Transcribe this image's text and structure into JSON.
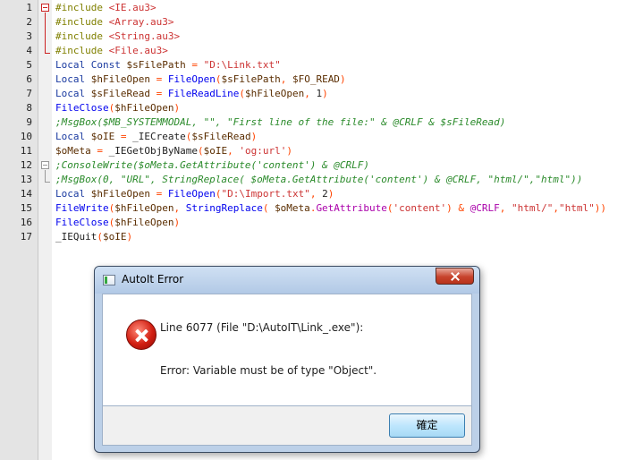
{
  "editor": {
    "line_numbers": [
      "1",
      "2",
      "3",
      "4",
      "5",
      "6",
      "7",
      "8",
      "9",
      "10",
      "11",
      "12",
      "13",
      "14",
      "15",
      "16",
      "17"
    ],
    "lines": [
      [
        {
          "t": "#include ",
          "c": "pre"
        },
        {
          "t": "<IE.au3>",
          "c": "inc"
        }
      ],
      [
        {
          "t": "#include ",
          "c": "pre"
        },
        {
          "t": "<Array.au3>",
          "c": "inc"
        }
      ],
      [
        {
          "t": "#include ",
          "c": "pre"
        },
        {
          "t": "<String.au3>",
          "c": "inc"
        }
      ],
      [
        {
          "t": "#include ",
          "c": "pre"
        },
        {
          "t": "<File.au3>",
          "c": "inc"
        }
      ],
      [
        {
          "t": "Local Const ",
          "c": "kw"
        },
        {
          "t": "$sFilePath",
          "c": "var"
        },
        {
          "t": " = ",
          "c": "op"
        },
        {
          "t": "\"D:\\Link.txt\"",
          "c": "str"
        }
      ],
      [
        {
          "t": "Local ",
          "c": "kw"
        },
        {
          "t": "$hFileOpen",
          "c": "var"
        },
        {
          "t": " = ",
          "c": "op"
        },
        {
          "t": "FileOpen",
          "c": "fn"
        },
        {
          "t": "(",
          "c": "op"
        },
        {
          "t": "$sFilePath",
          "c": "var"
        },
        {
          "t": ", ",
          "c": "op"
        },
        {
          "t": "$FO_READ",
          "c": "var"
        },
        {
          "t": ")",
          "c": "op"
        }
      ],
      [
        {
          "t": "Local ",
          "c": "kw"
        },
        {
          "t": "$sFileRead",
          "c": "var"
        },
        {
          "t": " = ",
          "c": "op"
        },
        {
          "t": "FileReadLine",
          "c": "fn"
        },
        {
          "t": "(",
          "c": "op"
        },
        {
          "t": "$hFileOpen",
          "c": "var"
        },
        {
          "t": ", ",
          "c": "op"
        },
        {
          "t": "1",
          "c": "txt"
        },
        {
          "t": ")",
          "c": "op"
        }
      ],
      [
        {
          "t": "FileClose",
          "c": "fn"
        },
        {
          "t": "(",
          "c": "op"
        },
        {
          "t": "$hFileOpen",
          "c": "var"
        },
        {
          "t": ")",
          "c": "op"
        }
      ],
      [
        {
          "t": ";MsgBox($MB_SYSTEMMODAL, \"\", \"First line of the file:\" & @CRLF & $sFileRead)",
          "c": "cm"
        }
      ],
      [
        {
          "t": "Local ",
          "c": "kw"
        },
        {
          "t": "$oIE",
          "c": "var"
        },
        {
          "t": " = ",
          "c": "op"
        },
        {
          "t": "_IECreate",
          "c": "txt"
        },
        {
          "t": "(",
          "c": "op"
        },
        {
          "t": "$sFileRead",
          "c": "var"
        },
        {
          "t": ")",
          "c": "op"
        }
      ],
      [
        {
          "t": "$oMeta",
          "c": "var"
        },
        {
          "t": " = ",
          "c": "op"
        },
        {
          "t": "_IEGetObjByName",
          "c": "txt"
        },
        {
          "t": "(",
          "c": "op"
        },
        {
          "t": "$oIE",
          "c": "var"
        },
        {
          "t": ", ",
          "c": "op"
        },
        {
          "t": "'og:url'",
          "c": "str"
        },
        {
          "t": ")",
          "c": "op"
        }
      ],
      [
        {
          "t": ";ConsoleWrite($oMeta.GetAttribute('content') & @CRLF)",
          "c": "cm"
        }
      ],
      [
        {
          "t": ";MsgBox(0, \"URL\", StringReplace( $oMeta.GetAttribute('content') & @CRLF, \"html/\",\"html\"))",
          "c": "cm"
        }
      ],
      [
        {
          "t": "Local ",
          "c": "kw"
        },
        {
          "t": "$hFileOpen",
          "c": "var"
        },
        {
          "t": " = ",
          "c": "op"
        },
        {
          "t": "FileOpen",
          "c": "fn"
        },
        {
          "t": "(",
          "c": "op"
        },
        {
          "t": "\"D:\\Import.txt\"",
          "c": "str"
        },
        {
          "t": ", ",
          "c": "op"
        },
        {
          "t": "2",
          "c": "txt"
        },
        {
          "t": ")",
          "c": "op"
        }
      ],
      [
        {
          "t": "FileWrite",
          "c": "fn"
        },
        {
          "t": "(",
          "c": "op"
        },
        {
          "t": "$hFileOpen",
          "c": "var"
        },
        {
          "t": ", ",
          "c": "op"
        },
        {
          "t": "StringReplace",
          "c": "fn"
        },
        {
          "t": "( ",
          "c": "op"
        },
        {
          "t": "$oMeta",
          "c": "var"
        },
        {
          "t": ".",
          "c": "op"
        },
        {
          "t": "GetAttribute",
          "c": "macro"
        },
        {
          "t": "(",
          "c": "op"
        },
        {
          "t": "'content'",
          "c": "str"
        },
        {
          "t": ") & ",
          "c": "op"
        },
        {
          "t": "@CRLF",
          "c": "macro"
        },
        {
          "t": ", ",
          "c": "op"
        },
        {
          "t": "\"html/\"",
          "c": "str"
        },
        {
          "t": ",",
          "c": "op"
        },
        {
          "t": "\"html\"",
          "c": "str"
        },
        {
          "t": "))",
          "c": "op"
        }
      ],
      [
        {
          "t": "FileClose",
          "c": "fn"
        },
        {
          "t": "(",
          "c": "op"
        },
        {
          "t": "$hFileOpen",
          "c": "var"
        },
        {
          "t": ")",
          "c": "op"
        }
      ],
      [
        {
          "t": "_IEQuit",
          "c": "txt"
        },
        {
          "t": "(",
          "c": "op"
        },
        {
          "t": "$oIE",
          "c": "var"
        },
        {
          "t": ")",
          "c": "op"
        }
      ]
    ]
  },
  "dialog": {
    "title": "AutoIt Error",
    "line_message": "Line 6077  (File \"D:\\AutoIT\\Link_.exe\"):",
    "error_message": "Error: Variable must be of type \"Object\".",
    "ok_label": "確定",
    "icon": "error-icon"
  }
}
